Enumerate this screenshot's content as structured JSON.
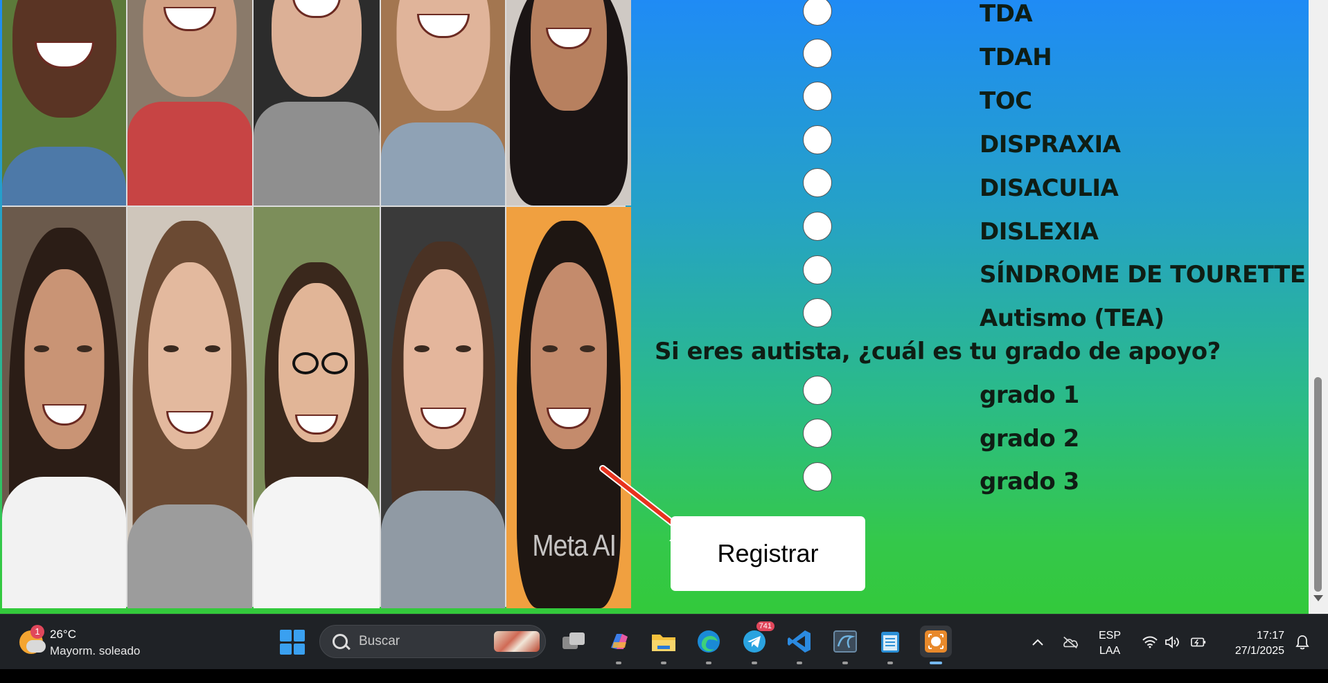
{
  "form": {
    "options_conditions": [
      {
        "label": "TDA"
      },
      {
        "label": "TDAH"
      },
      {
        "label": "TOC"
      },
      {
        "label": "DISPRAXIA"
      },
      {
        "label": "DISACULIA"
      },
      {
        "label": "DISLEXIA"
      },
      {
        "label": "SÍNDROME DE TOURETTE"
      },
      {
        "label": "Autismo (TEA)"
      }
    ],
    "question_support": "Si eres autista, ¿cuál es tu grado de apoyo?",
    "options_support": [
      {
        "label": "grado 1"
      },
      {
        "label": "grado 2"
      },
      {
        "label": "grado 3"
      }
    ],
    "register_label": "Registrar"
  },
  "collage": {
    "watermark": "Meta AI"
  },
  "taskbar": {
    "weather": {
      "badge": "1",
      "temp": "26°C",
      "condition": "Mayorm. soleado"
    },
    "search_placeholder": "Buscar",
    "apps": [
      "task-view",
      "copilot",
      "file-explorer",
      "edge",
      "telegram",
      "vscode",
      "mysql-workbench",
      "notepad",
      "screen-recorder"
    ],
    "telegram_badge": "741",
    "lang": {
      "line1": "ESP",
      "line2": "LAA"
    },
    "clock": {
      "time": "17:17",
      "date": "27/1/2025"
    }
  },
  "colors": {
    "gradient_top": "#1f8bf5",
    "gradient_bottom": "#33c93b",
    "arrow": "#e8321e"
  }
}
